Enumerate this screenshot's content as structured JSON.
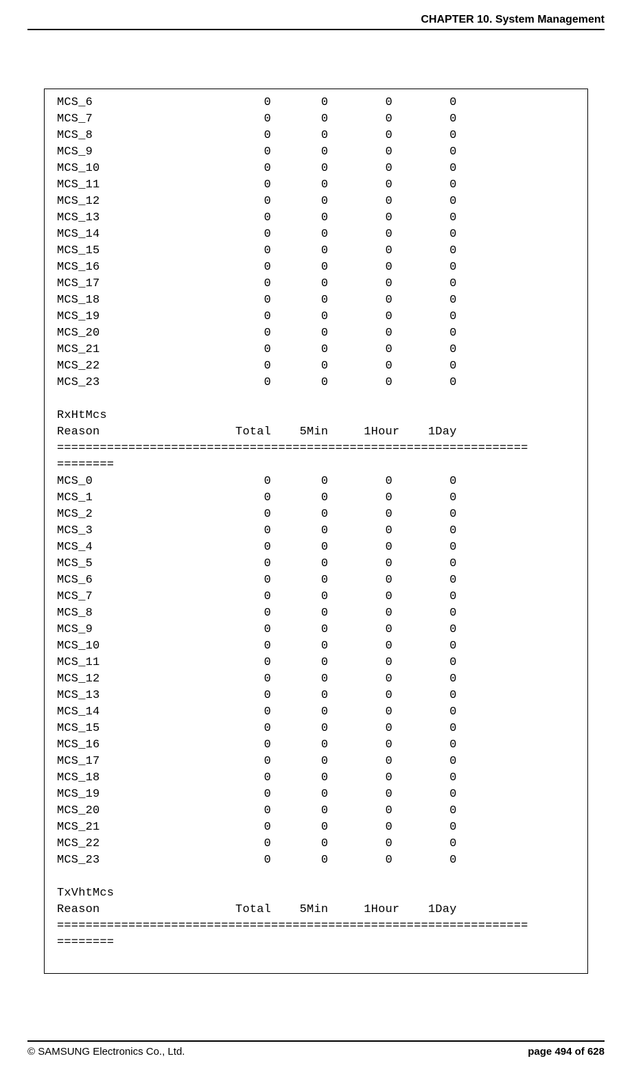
{
  "header": {
    "title": "CHAPTER 10. System Management"
  },
  "footer": {
    "copyright": "© SAMSUNG Electronics Co., Ltd.",
    "page": "page 494 of 628"
  },
  "sections": [
    {
      "rows": [
        {
          "label": "MCS_6",
          "total": "0",
          "m5": "0",
          "h1": "0",
          "d1": "0"
        },
        {
          "label": "MCS_7",
          "total": "0",
          "m5": "0",
          "h1": "0",
          "d1": "0"
        },
        {
          "label": "MCS_8",
          "total": "0",
          "m5": "0",
          "h1": "0",
          "d1": "0"
        },
        {
          "label": "MCS_9",
          "total": "0",
          "m5": "0",
          "h1": "0",
          "d1": "0"
        },
        {
          "label": "MCS_10",
          "total": "0",
          "m5": "0",
          "h1": "0",
          "d1": "0"
        },
        {
          "label": "MCS_11",
          "total": "0",
          "m5": "0",
          "h1": "0",
          "d1": "0"
        },
        {
          "label": "MCS_12",
          "total": "0",
          "m5": "0",
          "h1": "0",
          "d1": "0"
        },
        {
          "label": "MCS_13",
          "total": "0",
          "m5": "0",
          "h1": "0",
          "d1": "0"
        },
        {
          "label": "MCS_14",
          "total": "0",
          "m5": "0",
          "h1": "0",
          "d1": "0"
        },
        {
          "label": "MCS_15",
          "total": "0",
          "m5": "0",
          "h1": "0",
          "d1": "0"
        },
        {
          "label": "MCS_16",
          "total": "0",
          "m5": "0",
          "h1": "0",
          "d1": "0"
        },
        {
          "label": "MCS_17",
          "total": "0",
          "m5": "0",
          "h1": "0",
          "d1": "0"
        },
        {
          "label": "MCS_18",
          "total": "0",
          "m5": "0",
          "h1": "0",
          "d1": "0"
        },
        {
          "label": "MCS_19",
          "total": "0",
          "m5": "0",
          "h1": "0",
          "d1": "0"
        },
        {
          "label": "MCS_20",
          "total": "0",
          "m5": "0",
          "h1": "0",
          "d1": "0"
        },
        {
          "label": "MCS_21",
          "total": "0",
          "m5": "0",
          "h1": "0",
          "d1": "0"
        },
        {
          "label": "MCS_22",
          "total": "0",
          "m5": "0",
          "h1": "0",
          "d1": "0"
        },
        {
          "label": "MCS_23",
          "total": "0",
          "m5": "0",
          "h1": "0",
          "d1": "0"
        }
      ]
    },
    {
      "title": "RxHtMcs",
      "columns": {
        "reason": "Reason",
        "total": "Total",
        "m5": "5Min",
        "h1": "1Hour",
        "d1": "1Day"
      },
      "separator1": "==================================================================",
      "separator2": "========",
      "rows": [
        {
          "label": "MCS_0",
          "total": "0",
          "m5": "0",
          "h1": "0",
          "d1": "0"
        },
        {
          "label": "MCS_1",
          "total": "0",
          "m5": "0",
          "h1": "0",
          "d1": "0"
        },
        {
          "label": "MCS_2",
          "total": "0",
          "m5": "0",
          "h1": "0",
          "d1": "0"
        },
        {
          "label": "MCS_3",
          "total": "0",
          "m5": "0",
          "h1": "0",
          "d1": "0"
        },
        {
          "label": "MCS_4",
          "total": "0",
          "m5": "0",
          "h1": "0",
          "d1": "0"
        },
        {
          "label": "MCS_5",
          "total": "0",
          "m5": "0",
          "h1": "0",
          "d1": "0"
        },
        {
          "label": "MCS_6",
          "total": "0",
          "m5": "0",
          "h1": "0",
          "d1": "0"
        },
        {
          "label": "MCS_7",
          "total": "0",
          "m5": "0",
          "h1": "0",
          "d1": "0"
        },
        {
          "label": "MCS_8",
          "total": "0",
          "m5": "0",
          "h1": "0",
          "d1": "0"
        },
        {
          "label": "MCS_9",
          "total": "0",
          "m5": "0",
          "h1": "0",
          "d1": "0"
        },
        {
          "label": "MCS_10",
          "total": "0",
          "m5": "0",
          "h1": "0",
          "d1": "0"
        },
        {
          "label": "MCS_11",
          "total": "0",
          "m5": "0",
          "h1": "0",
          "d1": "0"
        },
        {
          "label": "MCS_12",
          "total": "0",
          "m5": "0",
          "h1": "0",
          "d1": "0"
        },
        {
          "label": "MCS_13",
          "total": "0",
          "m5": "0",
          "h1": "0",
          "d1": "0"
        },
        {
          "label": "MCS_14",
          "total": "0",
          "m5": "0",
          "h1": "0",
          "d1": "0"
        },
        {
          "label": "MCS_15",
          "total": "0",
          "m5": "0",
          "h1": "0",
          "d1": "0"
        },
        {
          "label": "MCS_16",
          "total": "0",
          "m5": "0",
          "h1": "0",
          "d1": "0"
        },
        {
          "label": "MCS_17",
          "total": "0",
          "m5": "0",
          "h1": "0",
          "d1": "0"
        },
        {
          "label": "MCS_18",
          "total": "0",
          "m5": "0",
          "h1": "0",
          "d1": "0"
        },
        {
          "label": "MCS_19",
          "total": "0",
          "m5": "0",
          "h1": "0",
          "d1": "0"
        },
        {
          "label": "MCS_20",
          "total": "0",
          "m5": "0",
          "h1": "0",
          "d1": "0"
        },
        {
          "label": "MCS_21",
          "total": "0",
          "m5": "0",
          "h1": "0",
          "d1": "0"
        },
        {
          "label": "MCS_22",
          "total": "0",
          "m5": "0",
          "h1": "0",
          "d1": "0"
        },
        {
          "label": "MCS_23",
          "total": "0",
          "m5": "0",
          "h1": "0",
          "d1": "0"
        }
      ]
    },
    {
      "title": "TxVhtMcs",
      "columns": {
        "reason": "Reason",
        "total": "Total",
        "m5": "5Min",
        "h1": "1Hour",
        "d1": "1Day"
      },
      "separator1": "==================================================================",
      "separator2": "========",
      "rows": []
    }
  ]
}
